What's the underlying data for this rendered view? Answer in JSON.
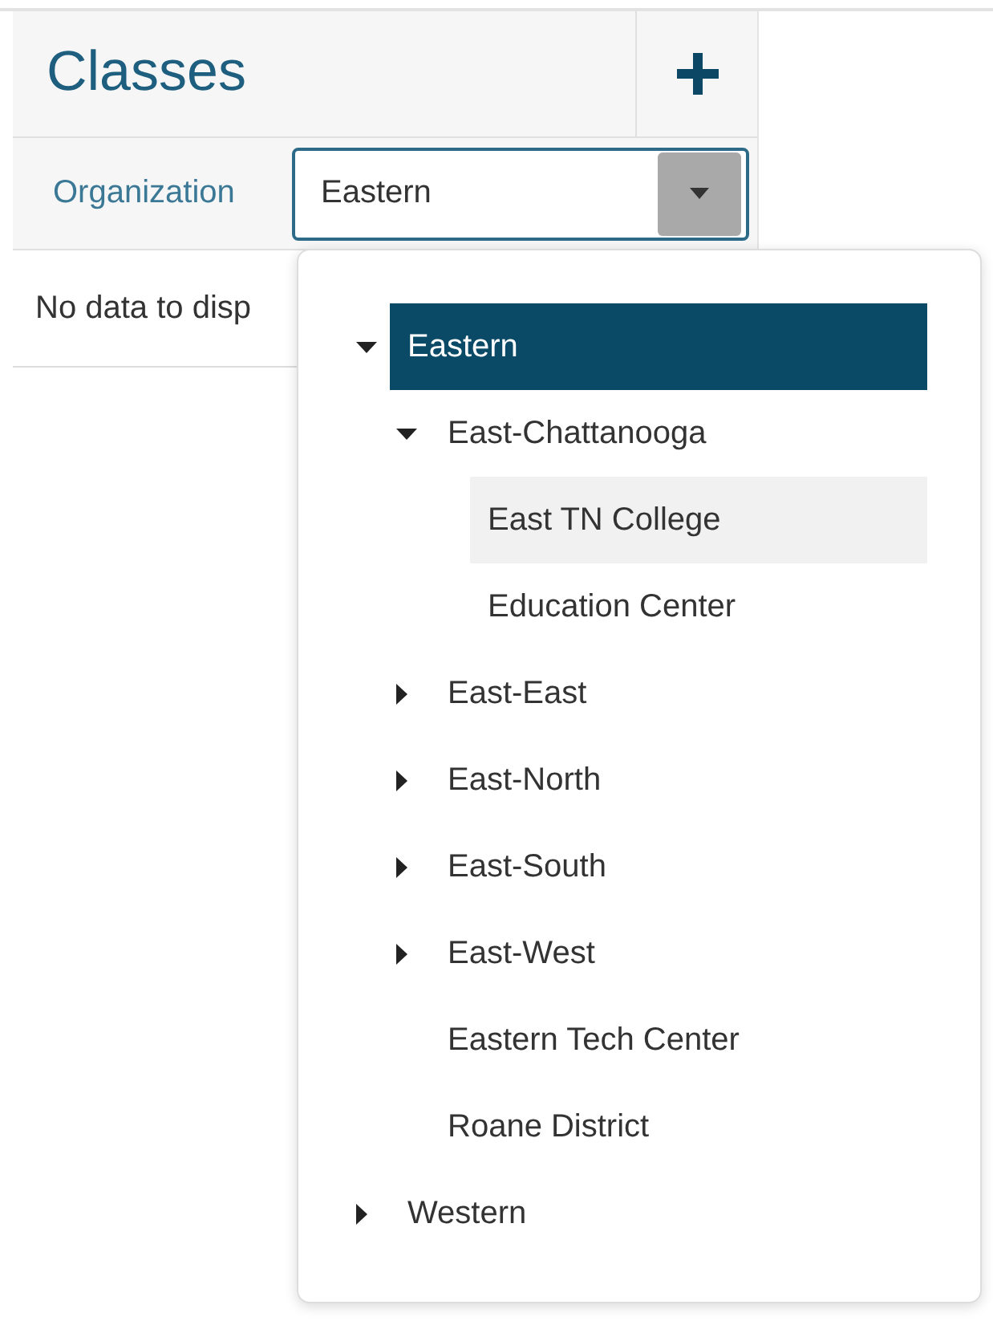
{
  "panel": {
    "title": "Classes",
    "filter": {
      "label": "Organization",
      "value": "Eastern"
    },
    "empty_message": "No data to disp"
  },
  "dropdown": {
    "tree": [
      {
        "label": "Eastern",
        "kind": "branch",
        "expanded": true,
        "selected": true,
        "hovered": false,
        "children": [
          {
            "label": "East-Chattanooga",
            "kind": "branch",
            "expanded": true,
            "selected": false,
            "hovered": false,
            "children": [
              {
                "label": "East TN College",
                "kind": "leaf",
                "selected": false,
                "hovered": true
              },
              {
                "label": "Education Center",
                "kind": "leaf",
                "selected": false,
                "hovered": false
              }
            ]
          },
          {
            "label": "East-East",
            "kind": "branch",
            "expanded": false,
            "selected": false,
            "hovered": false
          },
          {
            "label": "East-North",
            "kind": "branch",
            "expanded": false,
            "selected": false,
            "hovered": false
          },
          {
            "label": "East-South",
            "kind": "branch",
            "expanded": false,
            "selected": false,
            "hovered": false
          },
          {
            "label": "East-West",
            "kind": "branch",
            "expanded": false,
            "selected": false,
            "hovered": false
          },
          {
            "label": "Eastern Tech Center",
            "kind": "leaf",
            "selected": false,
            "hovered": false
          },
          {
            "label": "Roane District",
            "kind": "leaf",
            "selected": false,
            "hovered": false
          }
        ]
      },
      {
        "label": "Western",
        "kind": "branch",
        "expanded": false,
        "selected": false,
        "hovered": false
      }
    ]
  }
}
